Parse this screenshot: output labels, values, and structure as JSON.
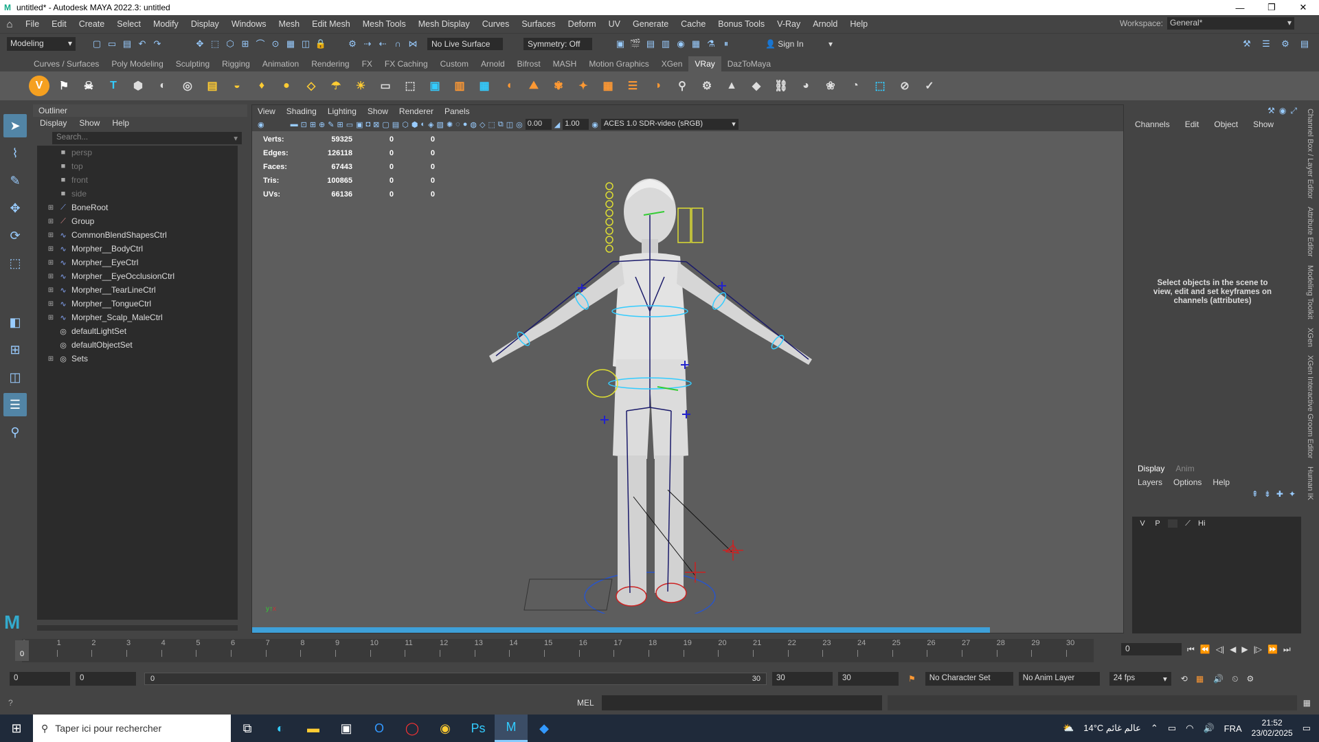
{
  "window": {
    "title": "untitled* - Autodesk MAYA 2022.3: untitled",
    "logo": "M"
  },
  "menubar": [
    "File",
    "Edit",
    "Create",
    "Select",
    "Modify",
    "Display",
    "Windows",
    "Mesh",
    "Edit Mesh",
    "Mesh Tools",
    "Mesh Display",
    "Curves",
    "Surfaces",
    "Deform",
    "UV",
    "Generate",
    "Cache",
    "Bonus Tools",
    "V-Ray",
    "Arnold",
    "Help"
  ],
  "workspace": {
    "label": "Workspace:",
    "value": "General*"
  },
  "statusline": {
    "mode": "Modeling",
    "live_surface": "No Live Surface",
    "symmetry": "Symmetry: Off",
    "sign_in": "Sign In"
  },
  "shelf_tabs": [
    "Curves / Surfaces",
    "Poly Modeling",
    "Sculpting",
    "Rigging",
    "Animation",
    "Rendering",
    "FX",
    "FX Caching",
    "Custom",
    "Arnold",
    "Bifrost",
    "MASH",
    "Motion Graphics",
    "XGen",
    "VRay",
    "DazToMaya"
  ],
  "active_shelf": "VRay",
  "outliner": {
    "title": "Outliner",
    "menu": [
      "Display",
      "Show",
      "Help"
    ],
    "search_placeholder": "Search...",
    "items": [
      {
        "label": "persp",
        "type": "camera",
        "expandable": false
      },
      {
        "label": "top",
        "type": "camera",
        "expandable": false
      },
      {
        "label": "front",
        "type": "camera",
        "expandable": false
      },
      {
        "label": "side",
        "type": "camera",
        "expandable": false
      },
      {
        "label": "BoneRoot",
        "type": "joint",
        "expandable": true
      },
      {
        "label": "Group",
        "type": "group",
        "expandable": true
      },
      {
        "label": "CommonBlendShapesCtrl",
        "type": "curve",
        "expandable": true
      },
      {
        "label": "Morpher__BodyCtrl",
        "type": "curve",
        "expandable": true
      },
      {
        "label": "Morpher__EyeCtrl",
        "type": "curve",
        "expandable": true
      },
      {
        "label": "Morpher__EyeOcclusionCtrl",
        "type": "curve",
        "expandable": true
      },
      {
        "label": "Morpher__TearLineCtrl",
        "type": "curve",
        "expandable": true
      },
      {
        "label": "Morpher__TongueCtrl",
        "type": "curve",
        "expandable": true
      },
      {
        "label": "Morpher_Scalp_MaleCtrl",
        "type": "curve",
        "expandable": true
      },
      {
        "label": "defaultLightSet",
        "type": "set",
        "expandable": false
      },
      {
        "label": "defaultObjectSet",
        "type": "set",
        "expandable": false
      },
      {
        "label": "Sets",
        "type": "set",
        "expandable": true
      }
    ]
  },
  "viewport": {
    "menu": [
      "View",
      "Shading",
      "Lighting",
      "Show",
      "Renderer",
      "Panels"
    ],
    "exposure": "0.00",
    "gamma": "1.00",
    "color_space": "ACES 1.0 SDR-video (sRGB)",
    "hud": [
      {
        "label": "Verts:",
        "value": "59325",
        "a": "0",
        "b": "0"
      },
      {
        "label": "Edges:",
        "value": "126118",
        "a": "0",
        "b": "0"
      },
      {
        "label": "Faces:",
        "value": "67443",
        "a": "0",
        "b": "0"
      },
      {
        "label": "Tris:",
        "value": "100865",
        "a": "0",
        "b": "0"
      },
      {
        "label": "UVs:",
        "value": "66136",
        "a": "0",
        "b": "0"
      }
    ]
  },
  "channel_box": {
    "menu": [
      "Channels",
      "Edit",
      "Object",
      "Show"
    ],
    "message": "Select objects in the scene to view, edit and set keyframes on channels (attributes)"
  },
  "layer_editor": {
    "tabs": [
      "Display",
      "Anim"
    ],
    "menu": [
      "Layers",
      "Options",
      "Help"
    ],
    "row": {
      "v": "V",
      "p": "P",
      "name": "Hi"
    }
  },
  "side_tabs": [
    "Channel Box / Layer Editor",
    "Attribute Editor",
    "Modeling Toolkit",
    "XGen",
    "XGen Interactive Groom Editor",
    "Human IK"
  ],
  "timeline": {
    "ticks": [
      "0",
      "1",
      "2",
      "3",
      "4",
      "5",
      "6",
      "7",
      "8",
      "9",
      "10",
      "11",
      "12",
      "13",
      "14",
      "15",
      "16",
      "17",
      "18",
      "19",
      "20",
      "21",
      "22",
      "23",
      "24",
      "25",
      "26",
      "27",
      "28",
      "29",
      "30"
    ],
    "current_frame": "0",
    "frame_field": "0"
  },
  "range": {
    "start": "0",
    "anim_start": "0",
    "slider_start": "0",
    "slider_end": "30",
    "anim_end": "30",
    "end": "30",
    "character_set": "No Character Set",
    "anim_layer": "No Anim Layer",
    "fps": "24 fps"
  },
  "cmdline": {
    "label": "MEL"
  },
  "taskbar": {
    "search_placeholder": "Taper ici pour rechercher",
    "weather": "14°C عالم غائم",
    "lang": "FRA",
    "time": "21:52",
    "date": "23/02/2025"
  }
}
